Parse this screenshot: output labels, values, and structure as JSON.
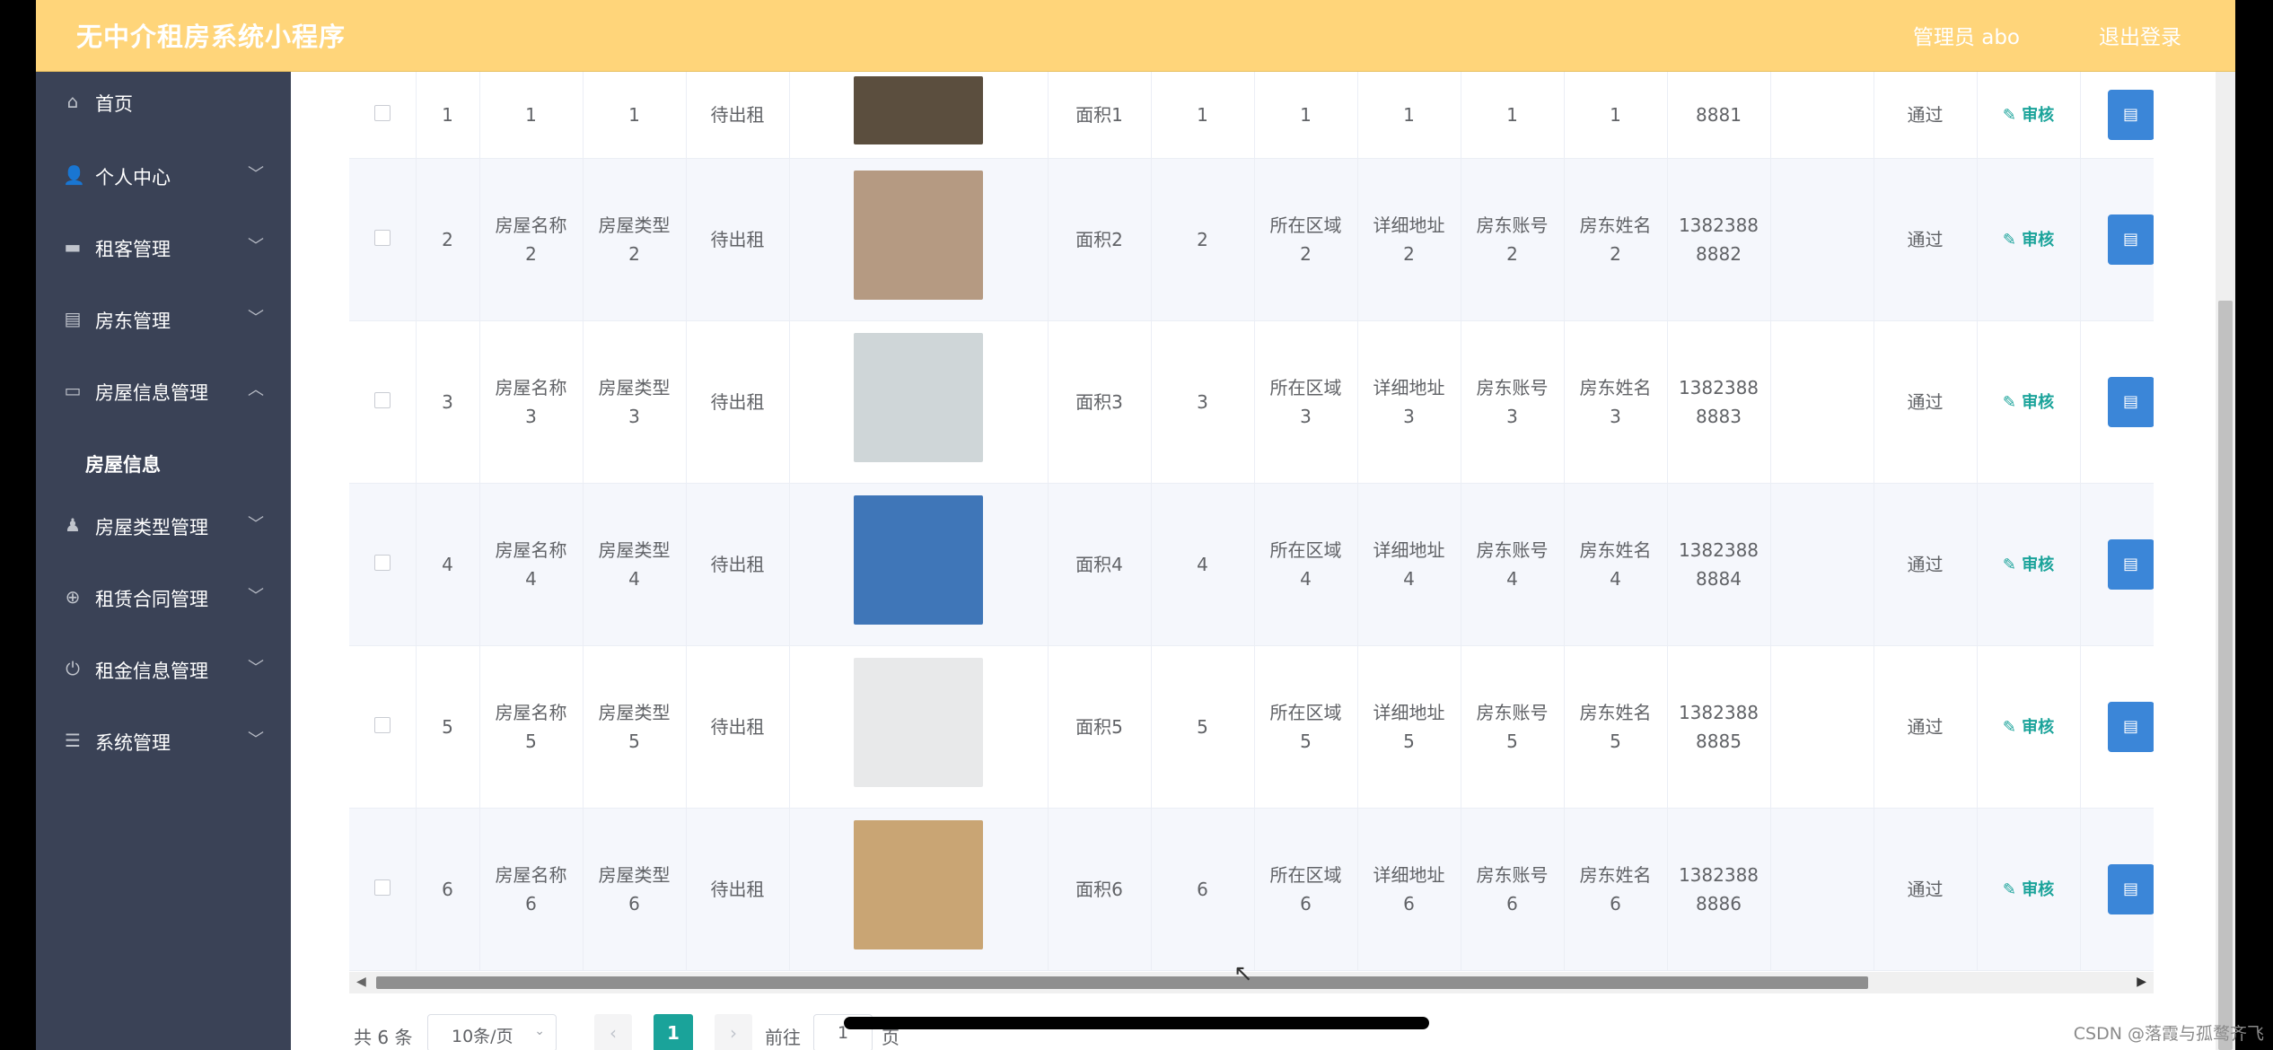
{
  "header": {
    "title": "无中介租房系统小程序",
    "admin": "管理员 abo",
    "logout": "退出登录"
  },
  "sidebar": {
    "items": [
      {
        "label": "首页",
        "icon": "home-icon",
        "glyph": "⌂"
      },
      {
        "label": "个人中心",
        "icon": "user-icon",
        "glyph": "👤"
      },
      {
        "label": "租客管理",
        "icon": "monitor-icon",
        "glyph": "▬"
      },
      {
        "label": "房东管理",
        "icon": "clipboard-icon",
        "glyph": "▤"
      },
      {
        "label": "房屋信息管理",
        "icon": "card-icon",
        "glyph": "▭"
      },
      {
        "label": "房屋类型管理",
        "icon": "person-icon",
        "glyph": "♟"
      },
      {
        "label": "租赁合同管理",
        "icon": "target-icon",
        "glyph": "⊕"
      },
      {
        "label": "租金信息管理",
        "icon": "power-icon",
        "glyph": "⏻"
      },
      {
        "label": "系统管理",
        "icon": "list-icon",
        "glyph": "☰"
      }
    ],
    "submenu": {
      "label": "房屋信息"
    }
  },
  "table": {
    "rows": [
      {
        "index": "1",
        "name": "1",
        "type": "1",
        "status": "待出租",
        "area": "面积1",
        "count": "1",
        "region": "1",
        "address": "1",
        "account": "1",
        "landlord": "1",
        "phone": "8881",
        "review": "通过",
        "audit": "审核",
        "img": "#5b4e3e"
      },
      {
        "index": "2",
        "name": "房屋名称\n2",
        "type": "房屋类型\n2",
        "status": "待出租",
        "area": "面积2",
        "count": "2",
        "region": "所在区域\n2",
        "address": "详细地址\n2",
        "account": "房东账号\n2",
        "landlord": "房东姓名\n2",
        "phone": "1382388\n8882",
        "review": "通过",
        "audit": "审核",
        "img": "#b59a82"
      },
      {
        "index": "3",
        "name": "房屋名称\n3",
        "type": "房屋类型\n3",
        "status": "待出租",
        "area": "面积3",
        "count": "3",
        "region": "所在区域\n3",
        "address": "详细地址\n3",
        "account": "房东账号\n3",
        "landlord": "房东姓名\n3",
        "phone": "1382388\n8883",
        "review": "通过",
        "audit": "审核",
        "img": "#cfd6d8"
      },
      {
        "index": "4",
        "name": "房屋名称\n4",
        "type": "房屋类型\n4",
        "status": "待出租",
        "area": "面积4",
        "count": "4",
        "region": "所在区域\n4",
        "address": "详细地址\n4",
        "account": "房东账号\n4",
        "landlord": "房东姓名\n4",
        "phone": "1382388\n8884",
        "review": "通过",
        "audit": "审核",
        "img": "#3f76b8"
      },
      {
        "index": "5",
        "name": "房屋名称\n5",
        "type": "房屋类型\n5",
        "status": "待出租",
        "area": "面积5",
        "count": "5",
        "region": "所在区域\n5",
        "address": "详细地址\n5",
        "account": "房东账号\n5",
        "landlord": "房东姓名\n5",
        "phone": "1382388\n8885",
        "review": "通过",
        "audit": "审核",
        "img": "#e8e9ea"
      },
      {
        "index": "6",
        "name": "房屋名称\n6",
        "type": "房屋类型\n6",
        "status": "待出租",
        "area": "面积6",
        "count": "6",
        "region": "所在区域\n6",
        "address": "详细地址\n6",
        "account": "房东账号\n6",
        "landlord": "房东姓名\n6",
        "phone": "1382388\n8886",
        "review": "通过",
        "audit": "审核",
        "img": "#c9a574"
      }
    ]
  },
  "pagination": {
    "total": "共 6 条",
    "page_size": "10条/页",
    "current": "1",
    "goto_label": "前往",
    "goto_value": "1",
    "goto_suffix": "页"
  },
  "watermark": "CSDN @落霞与孤鹜齐飞",
  "colors": {
    "header": "#ffd57a",
    "sidebar": "#3a4256",
    "accent": "#1aa39a",
    "button": "#3b86d8"
  }
}
